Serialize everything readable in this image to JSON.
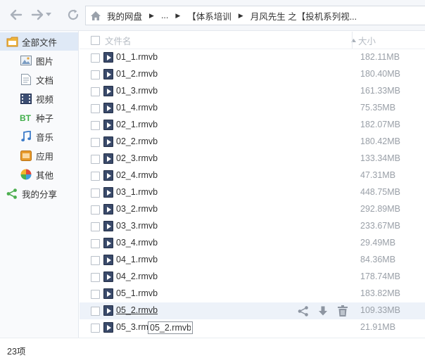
{
  "nav": {
    "crumbs": [
      "我的网盘",
      "...",
      "【体系培训",
      "月风先生 之【投机系列视..."
    ]
  },
  "sidebar": {
    "items": [
      {
        "label": "全部文件",
        "icon": "folder-icon"
      },
      {
        "label": "图片",
        "icon": "image-icon"
      },
      {
        "label": "文档",
        "icon": "document-icon"
      },
      {
        "label": "视频",
        "icon": "video-icon"
      },
      {
        "label": "种子",
        "icon": "bt-icon"
      },
      {
        "label": "音乐",
        "icon": "music-icon"
      },
      {
        "label": "应用",
        "icon": "app-icon"
      },
      {
        "label": "其他",
        "icon": "other-icon"
      },
      {
        "label": "我的分享",
        "icon": "share-icon"
      }
    ]
  },
  "list": {
    "header": {
      "name": "文件名",
      "size": "大小"
    },
    "files": [
      {
        "name": "01_1.rmvb",
        "size": "182.11MB"
      },
      {
        "name": "01_2.rmvb",
        "size": "180.40MB"
      },
      {
        "name": "01_3.rmvb",
        "size": "161.33MB"
      },
      {
        "name": "01_4.rmvb",
        "size": "75.35MB"
      },
      {
        "name": "02_1.rmvb",
        "size": "182.07MB"
      },
      {
        "name": "02_2.rmvb",
        "size": "180.42MB"
      },
      {
        "name": "02_3.rmvb",
        "size": "133.34MB"
      },
      {
        "name": "02_4.rmvb",
        "size": "47.31MB"
      },
      {
        "name": "03_1.rmvb",
        "size": "448.75MB"
      },
      {
        "name": "03_2.rmvb",
        "size": "292.89MB"
      },
      {
        "name": "03_3.rmvb",
        "size": "233.67MB"
      },
      {
        "name": "03_4.rmvb",
        "size": "29.49MB"
      },
      {
        "name": "04_1.rmvb",
        "size": "84.36MB"
      },
      {
        "name": "04_2.rmvb",
        "size": "178.74MB"
      },
      {
        "name": "05_1.rmvb",
        "size": "183.82MB"
      },
      {
        "name": "05_2.rmvb",
        "size": "109.33MB"
      },
      {
        "name": "05_3.rm",
        "size": "21.91MB"
      }
    ],
    "rename_value": "05_2.rmvb"
  },
  "status": {
    "count": "23项"
  }
}
